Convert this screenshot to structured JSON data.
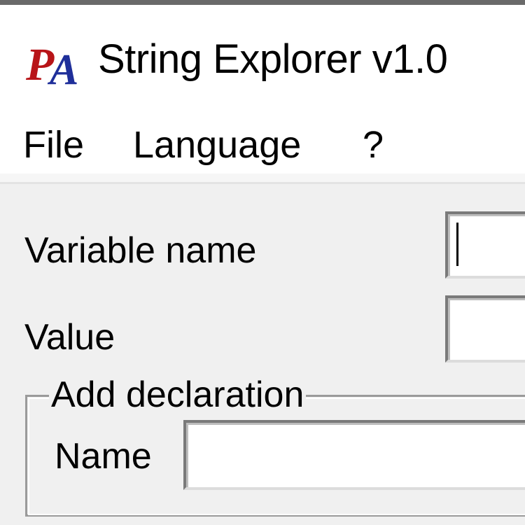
{
  "window": {
    "title": "String Explorer v1.0",
    "icon": "pa-app-icon",
    "icon_text": "PA"
  },
  "menu": {
    "items": [
      {
        "label": "File"
      },
      {
        "label": "Language"
      },
      {
        "label": "?"
      }
    ]
  },
  "form": {
    "variable_name_label": "Variable name",
    "variable_name_value": "",
    "value_label": "Value",
    "value_value": ""
  },
  "add_declaration": {
    "group_label": "Add declaration",
    "name_label": "Name",
    "name_value": ""
  },
  "colors": {
    "client_background": "#f0f0f0",
    "window_background": "#ffffff",
    "icon_red": "#b81418",
    "icon_blue": "#1f2f9a"
  }
}
